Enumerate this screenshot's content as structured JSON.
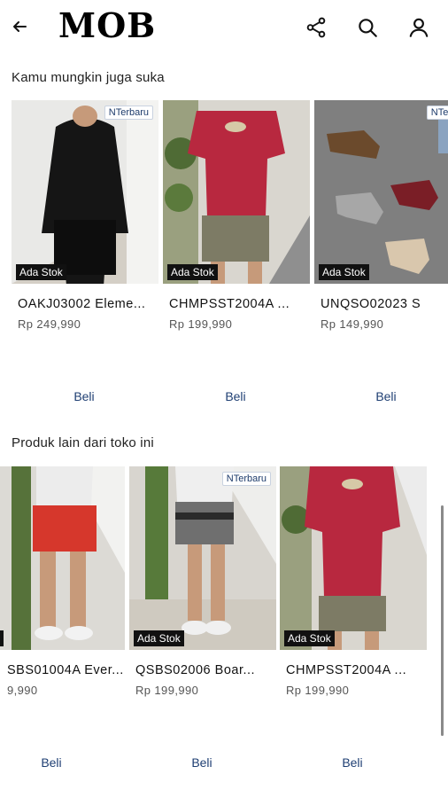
{
  "header": {
    "logo": "MOB"
  },
  "sections": [
    {
      "title": "Kamu mungkin juga suka",
      "products": [
        {
          "name": "OAKJ03002 Eleme...",
          "price": "Rp 249,990",
          "new_badge": "Terbaru",
          "stock": "Ada Stok",
          "buy": "Beli"
        },
        {
          "name": "CHMPSST2004A ...",
          "price": "Rp 199,990",
          "new_badge": "",
          "stock": "Ada Stok",
          "buy": "Beli"
        },
        {
          "name": "UNQSO02023 S",
          "price": "Rp 149,990",
          "new_badge": "Ter",
          "stock": "Ada Stok",
          "buy": "Beli"
        }
      ]
    },
    {
      "title": "Produk lain dari toko ini",
      "products": [
        {
          "name": "SBS01004A Ever...",
          "price": "9,990",
          "new_badge": "",
          "stock": "tok",
          "buy": "Beli"
        },
        {
          "name": "QSBS02006 Boar...",
          "price": "Rp 199,990",
          "new_badge": "Terbaru",
          "stock": "Ada Stok",
          "buy": "Beli"
        },
        {
          "name": "CHMPSST2004A ...",
          "price": "Rp 199,990",
          "new_badge": "",
          "stock": "Ada Stok",
          "buy": "Beli"
        }
      ]
    }
  ]
}
